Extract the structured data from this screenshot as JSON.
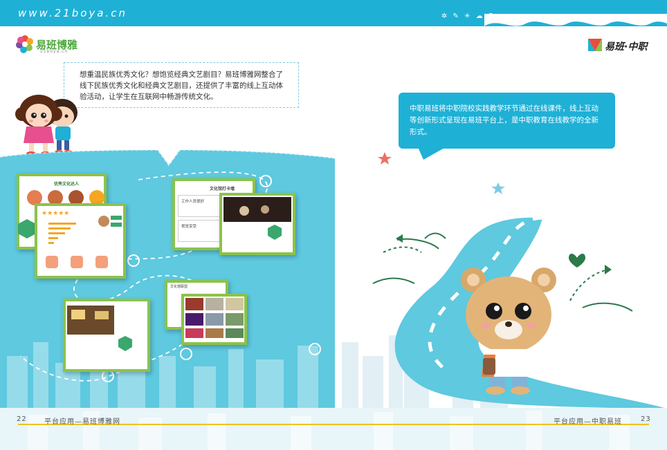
{
  "header": {
    "url": "www.21boya.cn"
  },
  "logos": {
    "left_name": "易班博雅",
    "left_sub": "21boya.cn",
    "right_name": "易班·中职"
  },
  "left_text": "想重温民族优秀文化？想饱览经典文艺剧目？易班博雅网整合了线下民族优秀文化和经典文艺剧目，还提供了丰富的线上互动体验活动，让学生在互联网中畅游传统文化。",
  "right_text": "中职易班将中职院校实践教学环节通过在线课件，线上互动等创新形式呈现在易班平台上，是中职教育在线教学的全新形式。",
  "screens": {
    "s1_title": "优秀文化达人",
    "s2_title": "",
    "s3_title": "文化馆打卡墙",
    "s3_item1": "工作人员很好",
    "s3_item2": "视觉享受",
    "s5_title": "文化馆联盟"
  },
  "footer": {
    "page_left": "22",
    "section_left": "平台应用—易班博雅网",
    "section_right": "平台应用—中职易班",
    "page_right": "23"
  },
  "colors": {
    "brand_blue": "#1fb0d6",
    "river": "#5ec9df",
    "accent_green": "#8bc34a",
    "footer_line": "#f0c21f"
  }
}
